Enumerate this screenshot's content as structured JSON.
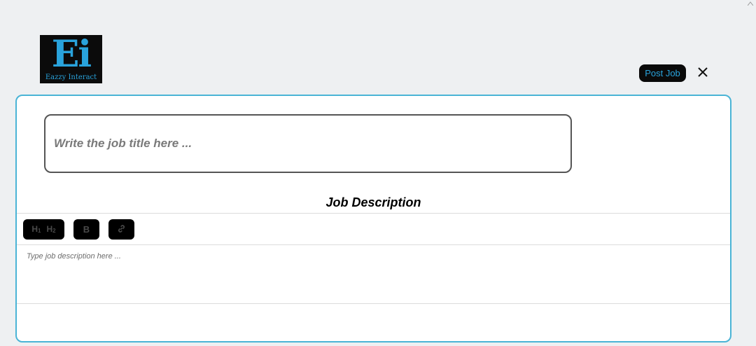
{
  "header": {
    "logo": {
      "letters": "Ei",
      "text": "Eazzy Interact"
    },
    "post_button": "Post Job",
    "close_icon": "close-icon"
  },
  "form": {
    "title_placeholder": "Write the job title here ...",
    "title_value": "",
    "description_heading": "Job Description",
    "toolbar": {
      "h1": "H",
      "h1_sub": "1",
      "h2": "H",
      "h2_sub": "2",
      "bold": "B",
      "link_icon": "link-icon"
    },
    "description_placeholder": "Type job description here ...",
    "description_value": ""
  },
  "colors": {
    "accent": "#29a3dc",
    "panel_border": "#4ab4d6",
    "background": "#eef0f2",
    "button_bg": "#0a0a0a"
  }
}
